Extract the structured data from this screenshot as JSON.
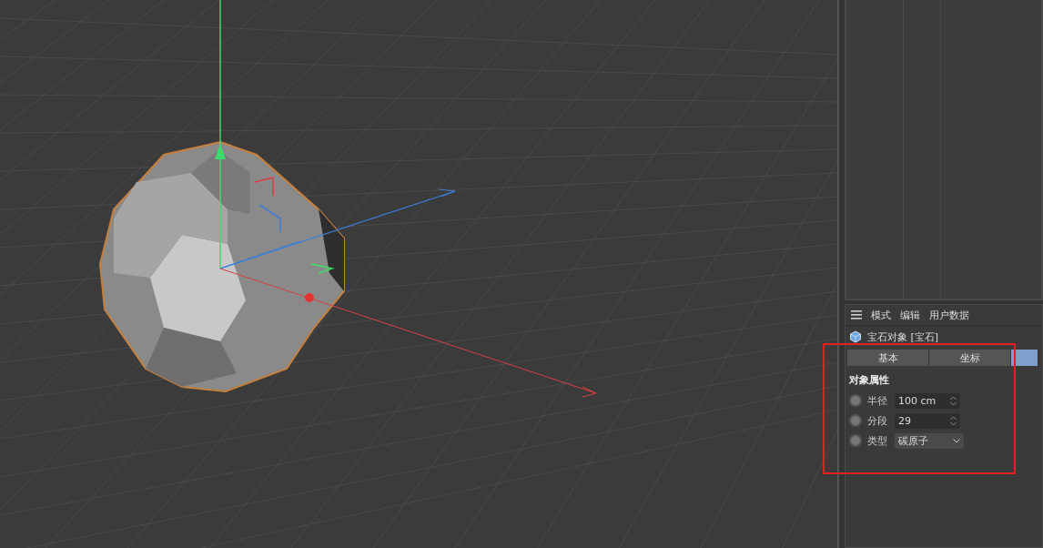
{
  "attribute_manager": {
    "menu": [
      "模式",
      "编辑",
      "用户数据"
    ],
    "object_title": "宝石对象 [宝石]",
    "tabs": [
      {
        "label": "基本",
        "selected": false
      },
      {
        "label": "坐标",
        "selected": false
      },
      {
        "selected": true
      }
    ],
    "section_title": "对象属性",
    "fields": [
      {
        "kind": "number",
        "label": "半径",
        "value": "100 cm"
      },
      {
        "kind": "number",
        "label": "分段",
        "value": "29"
      },
      {
        "kind": "dropdown",
        "label": "类型",
        "value": "碳原子"
      }
    ]
  }
}
